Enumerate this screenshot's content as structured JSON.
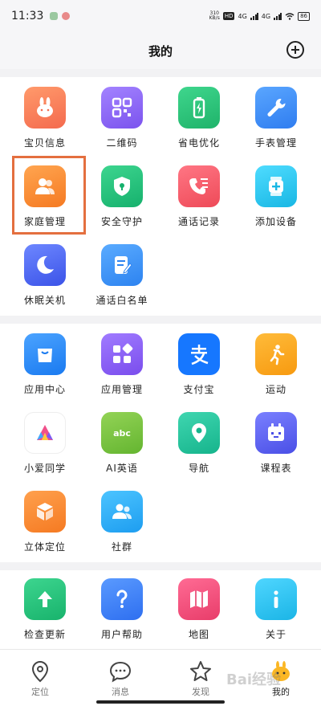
{
  "status_bar": {
    "time": "11:33",
    "net_speed_value": "310",
    "net_speed_unit": "KB/s",
    "hd_tag": "HD",
    "signal_1": "4G",
    "signal_2": "4G",
    "battery": "86"
  },
  "header": {
    "title": "我的"
  },
  "sections": [
    {
      "items": [
        {
          "label": "宝贝信息",
          "icon": "rabbit-icon",
          "color": "#f47a55"
        },
        {
          "label": "二维码",
          "icon": "qrcode-icon",
          "color": "#8a63f0"
        },
        {
          "label": "省电优化",
          "icon": "battery-icon",
          "color": "#2cc17b"
        },
        {
          "label": "手表管理",
          "icon": "wrench-icon",
          "color": "#3a8ff5"
        },
        {
          "label": "家庭管理",
          "icon": "family-icon",
          "color": "#f58a30"
        },
        {
          "label": "安全守护",
          "icon": "shield-icon",
          "color": "#22c07a"
        },
        {
          "label": "通话记录",
          "icon": "call-log-icon",
          "color": "#f25a66"
        },
        {
          "label": "添加设备",
          "icon": "add-device-icon",
          "color": "#27c6e8"
        },
        {
          "label": "休眠关机",
          "icon": "moon-icon",
          "color": "#4f6cf5"
        },
        {
          "label": "通话白名单",
          "icon": "whitelist-icon",
          "color": "#3a95f5"
        }
      ]
    },
    {
      "items": [
        {
          "label": "应用中心",
          "icon": "app-store-icon",
          "color": "#2e8ff5"
        },
        {
          "label": "应用管理",
          "icon": "apps-grid-icon",
          "color": "#8a5cf0"
        },
        {
          "label": "支付宝",
          "icon": "alipay-icon",
          "color": "#1677ff"
        },
        {
          "label": "运动",
          "icon": "running-icon",
          "color": "#f7a51c"
        },
        {
          "label": "小爱同学",
          "icon": "xiaoai-icon",
          "color": "#ffffff"
        },
        {
          "label": "AI英语",
          "icon": "abc-icon",
          "color": "#7cc242"
        },
        {
          "label": "导航",
          "icon": "location-pin-icon",
          "color": "#26c29d"
        },
        {
          "label": "课程表",
          "icon": "schedule-icon",
          "color": "#5a62f0"
        },
        {
          "label": "立体定位",
          "icon": "cube-icon",
          "color": "#f58a30"
        },
        {
          "label": "社群",
          "icon": "community-icon",
          "color": "#2eaef5"
        }
      ]
    },
    {
      "items": [
        {
          "label": "检查更新",
          "icon": "upload-arrow-icon",
          "color": "#2cc17b"
        },
        {
          "label": "用户帮助",
          "icon": "question-icon",
          "color": "#3a7ff5"
        },
        {
          "label": "地图",
          "icon": "map-icon",
          "color": "#ef4e7a"
        },
        {
          "label": "关于",
          "icon": "info-icon",
          "color": "#2ec4ea"
        }
      ]
    }
  ],
  "bottom_nav": [
    {
      "label": "定位",
      "icon": "location-icon"
    },
    {
      "label": "消息",
      "icon": "message-icon"
    },
    {
      "label": "发现",
      "icon": "star-icon"
    },
    {
      "label": "我的",
      "icon": "profile-icon",
      "active": true
    }
  ],
  "watermark": "Bai经验"
}
